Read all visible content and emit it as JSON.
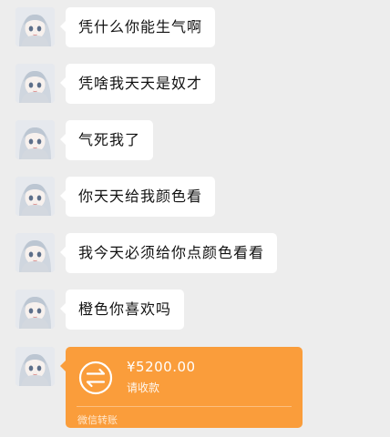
{
  "messages": [
    {
      "text": "凭什么你能生气啊"
    },
    {
      "text": "凭啥我天天是奴才"
    },
    {
      "text": "气死我了"
    },
    {
      "text": "你天天给我颜色看"
    },
    {
      "text": "我今天必须给你点颜色看看"
    },
    {
      "text": "橙色你喜欢吗"
    }
  ],
  "transfer": {
    "amount": "¥5200.00",
    "status": "请收款",
    "source": "微信转账",
    "color": "#fa9d3b",
    "icon": "transfer-arrows-icon"
  },
  "theme": {
    "background": "#ededed",
    "bubble": "#ffffff"
  },
  "avatar": {
    "icon": "anime-girl-avatar"
  }
}
